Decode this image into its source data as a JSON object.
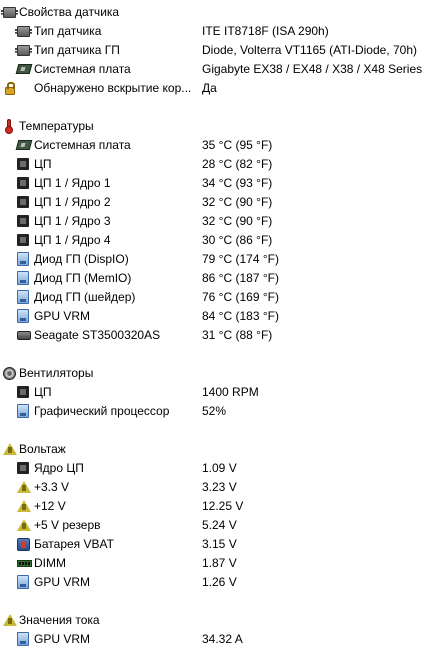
{
  "groups": [
    {
      "title": "Свойства датчика",
      "icon": "sensor-chip-icon",
      "items": [
        {
          "label": "Тип датчика",
          "value": "ITE IT8718F  (ISA 290h)",
          "icon": "sensor-chip-icon"
        },
        {
          "label": "Тип датчика ГП",
          "value": "Diode, Volterra VT1165  (ATI-Diode, 70h)",
          "icon": "sensor-chip-icon"
        },
        {
          "label": "Системная плата",
          "value": "Gigabyte EX38 / EX48 / X38 / X48 Series",
          "icon": "motherboard-icon"
        },
        {
          "label": "Обнаружено вскрытие кор...",
          "value": "Да",
          "icon": "lock-icon"
        }
      ]
    },
    {
      "title": "Температуры",
      "icon": "thermometer-icon",
      "items": [
        {
          "label": "Системная плата",
          "value": "35 °C  (95 °F)",
          "icon": "motherboard-icon"
        },
        {
          "label": "ЦП",
          "value": "28 °C  (82 °F)",
          "icon": "cpu-icon"
        },
        {
          "label": "ЦП 1 / Ядро 1",
          "value": "34 °C  (93 °F)",
          "icon": "cpu-icon"
        },
        {
          "label": "ЦП 1 / Ядро 2",
          "value": "32 °C  (90 °F)",
          "icon": "cpu-icon"
        },
        {
          "label": "ЦП 1 / Ядро 3",
          "value": "32 °C  (90 °F)",
          "icon": "cpu-icon"
        },
        {
          "label": "ЦП 1 / Ядро 4",
          "value": "30 °C  (86 °F)",
          "icon": "cpu-icon"
        },
        {
          "label": "Диод ГП (DispIO)",
          "value": "79 °C  (174 °F)",
          "icon": "gpu-icon"
        },
        {
          "label": "Диод ГП (MemIO)",
          "value": "86 °C  (187 °F)",
          "icon": "gpu-icon"
        },
        {
          "label": "Диод ГП (шейдер)",
          "value": "76 °C  (169 °F)",
          "icon": "gpu-icon"
        },
        {
          "label": "GPU VRM",
          "value": "84 °C  (183 °F)",
          "icon": "gpu-icon"
        },
        {
          "label": "Seagate ST3500320AS",
          "value": "31 °C  (88 °F)",
          "icon": "hard-drive-icon"
        }
      ]
    },
    {
      "title": "Вентиляторы",
      "icon": "fan-icon",
      "items": [
        {
          "label": "ЦП",
          "value": "1400 RPM",
          "icon": "cpu-icon"
        },
        {
          "label": "Графический процессор",
          "value": "52%",
          "icon": "gpu-icon"
        }
      ]
    },
    {
      "title": "Вольтаж",
      "icon": "voltage-icon",
      "items": [
        {
          "label": "Ядро ЦП",
          "value": "1.09 V",
          "icon": "cpu-icon"
        },
        {
          "label": "+3.3 V",
          "value": "3.23 V",
          "icon": "voltage-icon"
        },
        {
          "label": "+12 V",
          "value": "12.25 V",
          "icon": "voltage-icon"
        },
        {
          "label": "+5 V резерв",
          "value": "5.24 V",
          "icon": "voltage-icon"
        },
        {
          "label": "Батарея VBAT",
          "value": "3.15 V",
          "icon": "battery-icon"
        },
        {
          "label": "DIMM",
          "value": "1.87 V",
          "icon": "dimm-icon"
        },
        {
          "label": "GPU VRM",
          "value": "1.26 V",
          "icon": "gpu-icon"
        }
      ]
    },
    {
      "title": "Значения тока",
      "icon": "voltage-icon",
      "items": [
        {
          "label": "GPU VRM",
          "value": "34.32 A",
          "icon": "gpu-icon"
        }
      ]
    }
  ]
}
